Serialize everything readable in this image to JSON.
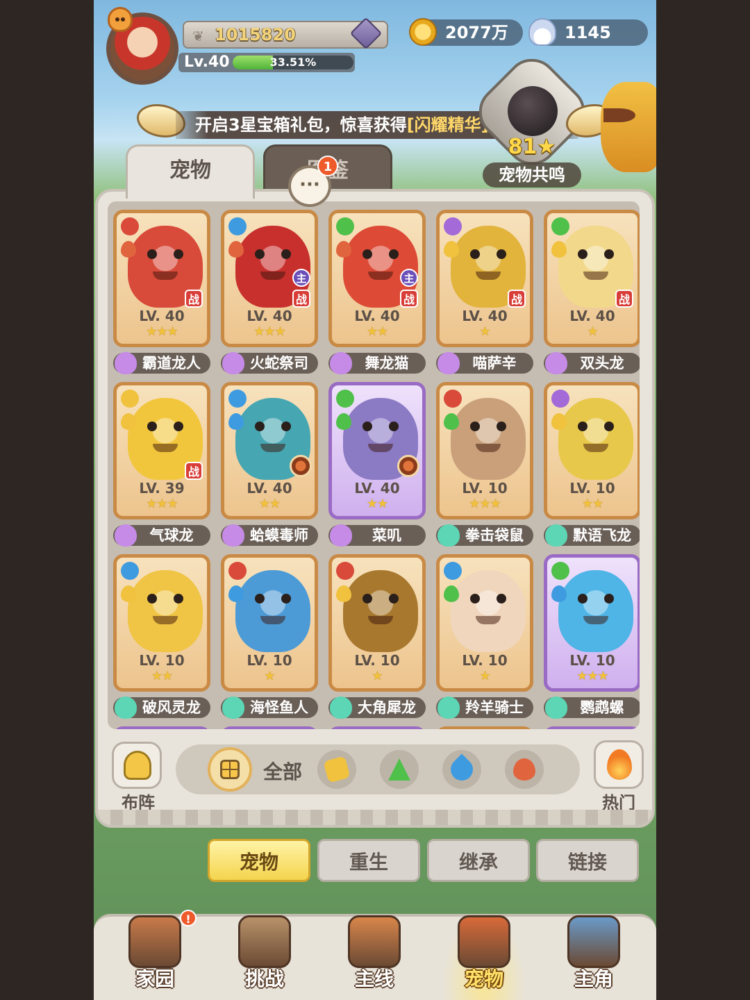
{
  "header": {
    "power": "1015820",
    "level": "Lv.40",
    "exp_percent": "33.51%",
    "exp_fraction": 0.3351,
    "gold": "2077万",
    "shells": "1145"
  },
  "banner": {
    "text": "开启3星宝箱礼包，惊喜获得",
    "highlight": "[闪耀精华]"
  },
  "resonance": {
    "count": "81",
    "star": "★",
    "label": "宠物共鸣"
  },
  "tabs": {
    "pets": "宠物",
    "second": "图鉴",
    "chat_badge": "1",
    "chat_glyph": "···"
  },
  "pets": [
    {
      "name": "霸道龙人",
      "level": "LV. 40",
      "stars": "★★★",
      "rarity": "orange",
      "paw_color": "#c58be6",
      "art_color": "#d84a3a",
      "el1": "#d94a3a",
      "el2": "#e0643e",
      "battle": "战",
      "main": "",
      "equip": false
    },
    {
      "name": "火蛇祭司",
      "level": "LV. 40",
      "stars": "★★★",
      "rarity": "orange",
      "paw_color": "#c58be6",
      "art_color": "#c8302e",
      "el1": "#3f9be0",
      "el2": "#e0643e",
      "battle": "战",
      "main": "主",
      "equip": false
    },
    {
      "name": "舞龙猫",
      "level": "LV. 40",
      "stars": "★★",
      "rarity": "orange",
      "paw_color": "#c58be6",
      "art_color": "#dd4a36",
      "el1": "#4fc04a",
      "el2": "#e0643e",
      "battle": "战",
      "main": "主",
      "equip": false
    },
    {
      "name": "喵萨辛",
      "level": "LV. 40",
      "stars": "★",
      "rarity": "orange",
      "paw_color": "#c58be6",
      "art_color": "#e2b43c",
      "el1": "#a36ad8",
      "el2": "#f0c23e",
      "battle": "战",
      "main": "",
      "equip": false
    },
    {
      "name": "双头龙",
      "level": "LV. 40",
      "stars": "★",
      "rarity": "orange",
      "paw_color": "#c58be6",
      "art_color": "#f2d88a",
      "el1": "#4fc04a",
      "el2": "#f0c23e",
      "battle": "战",
      "main": "",
      "equip": false
    },
    {
      "name": "气球龙",
      "level": "LV. 39",
      "stars": "★★★",
      "rarity": "orange",
      "paw_color": "#c58be6",
      "art_color": "#f2c63c",
      "el1": "#f0c23e",
      "el2": "#f0c23e",
      "battle": "战",
      "main": "",
      "equip": false
    },
    {
      "name": "蛤蟆毒师",
      "level": "LV. 40",
      "stars": "★★",
      "rarity": "orange",
      "paw_color": "#c58be6",
      "art_color": "#46a6b2",
      "el1": "#3f9be0",
      "el2": "#3f9be0",
      "battle": "",
      "main": "",
      "equip": true
    },
    {
      "name": "菜叽",
      "level": "LV. 40",
      "stars": "★★",
      "rarity": "purple",
      "paw_color": "#c58be6",
      "art_color": "#8b7ac4",
      "el1": "#4fc04a",
      "el2": "#4fc04a",
      "battle": "",
      "main": "",
      "equip": true
    },
    {
      "name": "拳击袋鼠",
      "level": "LV. 10",
      "stars": "★★★",
      "rarity": "orange",
      "paw_color": "#5cd6b4",
      "art_color": "#c9a07a",
      "el1": "#d94a3a",
      "el2": "#4fc04a",
      "battle": "",
      "main": "",
      "equip": false
    },
    {
      "name": "默语飞龙",
      "level": "LV. 10",
      "stars": "★★",
      "rarity": "orange",
      "paw_color": "#5cd6b4",
      "art_color": "#e8c84a",
      "el1": "#a36ad8",
      "el2": "#f0c23e",
      "battle": "",
      "main": "",
      "equip": false
    },
    {
      "name": "破风灵龙",
      "level": "LV. 10",
      "stars": "★★",
      "rarity": "orange",
      "paw_color": "#5cd6b4",
      "art_color": "#f0c444",
      "el1": "#3f9be0",
      "el2": "#f0c23e",
      "battle": "",
      "main": "",
      "equip": false
    },
    {
      "name": "海怪鱼人",
      "level": "LV. 10",
      "stars": "★",
      "rarity": "orange",
      "paw_color": "#5cd6b4",
      "art_color": "#4c9ad6",
      "el1": "#d94a3a",
      "el2": "#3f9be0",
      "battle": "",
      "main": "",
      "equip": false
    },
    {
      "name": "大角犀龙",
      "level": "LV. 10",
      "stars": "★",
      "rarity": "orange",
      "paw_color": "#5cd6b4",
      "art_color": "#a8782e",
      "el1": "#d94a3a",
      "el2": "#f0c23e",
      "battle": "",
      "main": "",
      "equip": false
    },
    {
      "name": "羚羊骑士",
      "level": "LV. 10",
      "stars": "★",
      "rarity": "orange",
      "paw_color": "#5cd6b4",
      "art_color": "#f0d6bc",
      "el1": "#3f9be0",
      "el2": "#4fc04a",
      "battle": "",
      "main": "",
      "equip": false
    },
    {
      "name": "鹦鹉螺",
      "level": "LV. 10",
      "stars": "★★★",
      "rarity": "purple",
      "paw_color": "#5cd6b4",
      "art_color": "#4fb4e6",
      "el1": "#4fc04a",
      "el2": "#3f9be0",
      "battle": "",
      "main": "",
      "equip": false
    }
  ],
  "filters": {
    "lineup": "布阵",
    "all": "全部",
    "hot": "热门",
    "elements": [
      {
        "icon": "earth-element-icon",
        "color": "#f0c23e"
      },
      {
        "icon": "grass-element-icon",
        "color": "#4fc04a"
      },
      {
        "icon": "water-element-icon",
        "color": "#3f9be0"
      },
      {
        "icon": "fire-element-icon",
        "color": "#e0643e"
      }
    ]
  },
  "subtabs": [
    {
      "label": "宠物",
      "active": true
    },
    {
      "label": "重生",
      "active": false
    },
    {
      "label": "继承",
      "active": false
    },
    {
      "label": "链接",
      "active": false
    }
  ],
  "nav": [
    {
      "label": "家园",
      "icon": "home-icon",
      "color": "#c87a4a",
      "active": false
    },
    {
      "label": "挑战",
      "icon": "challenge-icon",
      "color": "#b8926a",
      "active": false
    },
    {
      "label": "主线",
      "icon": "mainline-icon",
      "color": "#d8864a",
      "active": false
    },
    {
      "label": "宠物",
      "icon": "pet-icon",
      "color": "#d86a3a",
      "active": true
    },
    {
      "label": "主角",
      "icon": "hero-icon",
      "color": "#6a9ac8",
      "active": false
    }
  ],
  "nav_badge": "!"
}
